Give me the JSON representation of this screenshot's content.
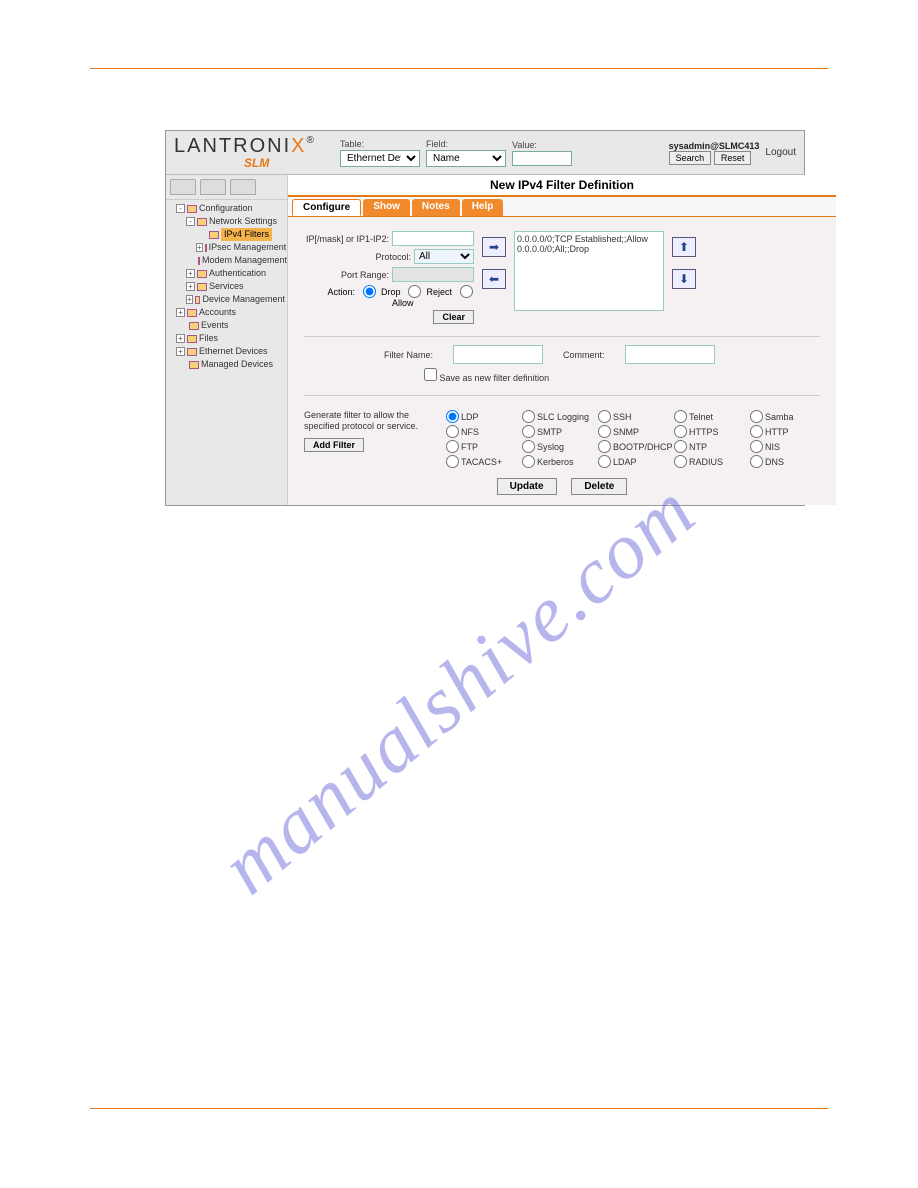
{
  "watermark": "manualshive.com",
  "topbar": {
    "logo": "LANTRONIX",
    "logo_sub": "SLM",
    "table_label": "Table:",
    "table_value": "Ethernet Device",
    "field_label": "Field:",
    "field_value": "Name",
    "value_label": "Value:",
    "value_value": "",
    "user": "sysadmin@SLMC413",
    "search_btn": "Search",
    "reset_btn": "Reset",
    "logout": "Logout"
  },
  "tree": {
    "items": [
      {
        "level": 0,
        "tog": "-",
        "label": "Configuration"
      },
      {
        "level": 1,
        "tog": "-",
        "label": "Network Settings"
      },
      {
        "level": 2,
        "tog": "",
        "label": "IPv4 Filters",
        "selected": true
      },
      {
        "level": 2,
        "tog": "+",
        "label": "IPsec Management"
      },
      {
        "level": 2,
        "tog": "",
        "label": "Modem Management"
      },
      {
        "level": 1,
        "tog": "+",
        "label": "Authentication"
      },
      {
        "level": 1,
        "tog": "+",
        "label": "Services"
      },
      {
        "level": 1,
        "tog": "+",
        "label": "Device Management"
      },
      {
        "level": 0,
        "tog": "+",
        "label": "Accounts"
      },
      {
        "level": 0,
        "tog": "",
        "label": "Events"
      },
      {
        "level": 0,
        "tog": "+",
        "label": "Files"
      },
      {
        "level": 0,
        "tog": "+",
        "label": "Ethernet Devices"
      },
      {
        "level": 0,
        "tog": "",
        "label": "Managed Devices"
      }
    ]
  },
  "page_title": "New IPv4 Filter Definition",
  "tabs": [
    "Configure",
    "Show",
    "Notes",
    "Help"
  ],
  "form": {
    "ip_label": "IP[/mask] or IP1-IP2:",
    "ip_value": "",
    "protocol_label": "Protocol:",
    "protocol_value": "All",
    "portrange_label": "Port Range:",
    "portrange_value": "",
    "action_label": "Action:",
    "action_drop": "Drop",
    "action_reject": "Reject",
    "action_allow": "Allow",
    "clear_btn": "Clear",
    "rules": [
      "0.0.0.0/0;TCP Established;;Allow",
      "0.0.0.0/0;All;;Drop"
    ],
    "filtername_label": "Filter Name:",
    "filtername_value": "",
    "comment_label": "Comment:",
    "comment_value": "",
    "save_chk_label": "Save as new filter definition",
    "gen_desc": "Generate filter to allow the specified protocol or service.",
    "addfilter_btn": "Add Filter",
    "protocols": [
      "LDP",
      "SLC Logging",
      "SSH",
      "Telnet",
      "Samba",
      "NFS",
      "SMTP",
      "SNMP",
      "HTTPS",
      "HTTP",
      "FTP",
      "Syslog",
      "BOOTP/DHCP",
      "NTP",
      "NIS",
      "TACACS+",
      "Kerberos",
      "LDAP",
      "RADIUS",
      "DNS"
    ],
    "update_btn": "Update",
    "delete_btn": "Delete"
  }
}
